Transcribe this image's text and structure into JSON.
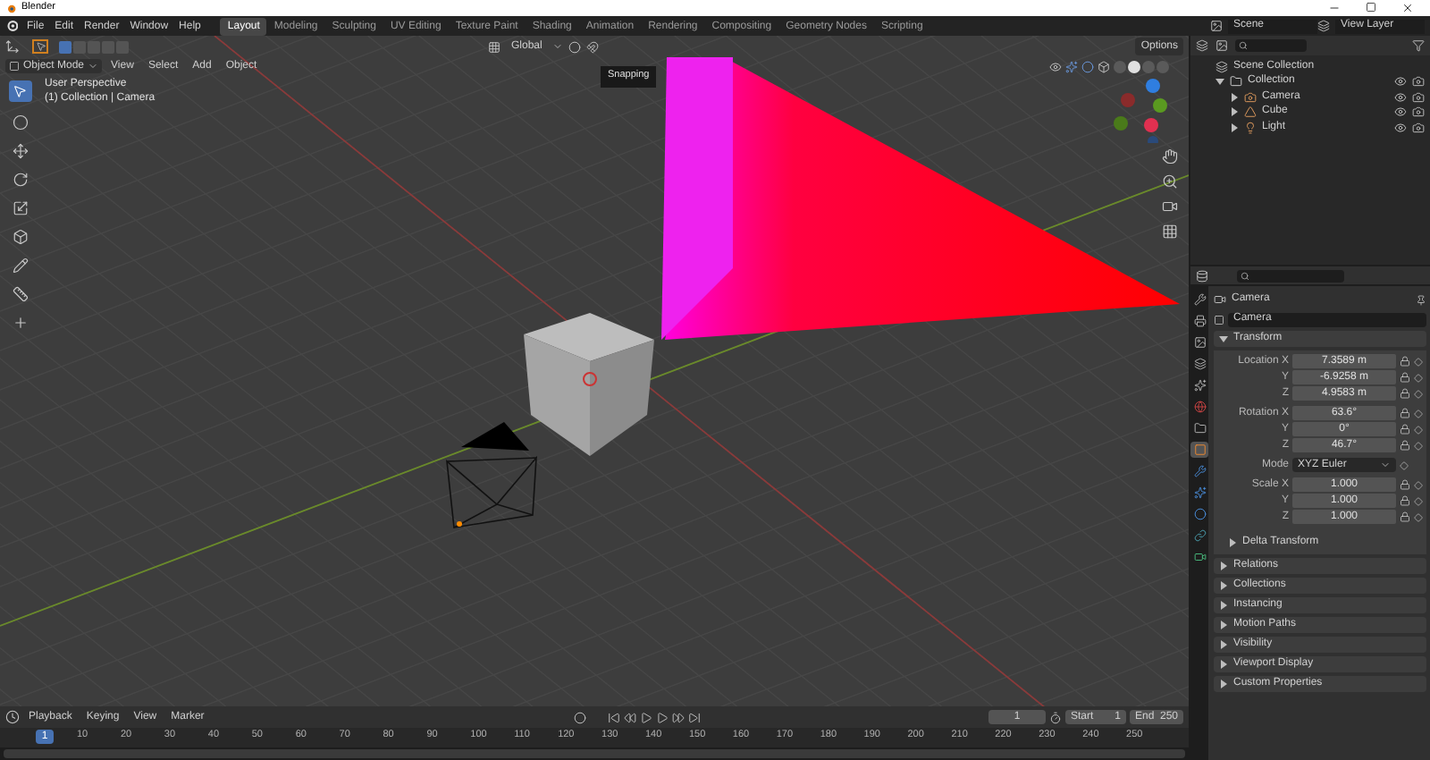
{
  "window": {
    "title": "Blender"
  },
  "menu": [
    "File",
    "Edit",
    "Render",
    "Window",
    "Help"
  ],
  "workspaces": [
    {
      "label": "Layout",
      "selected": true
    },
    {
      "label": "Modeling",
      "selected": false
    },
    {
      "label": "Sculpting",
      "selected": false
    },
    {
      "label": "UV Editing",
      "selected": false
    },
    {
      "label": "Texture Paint",
      "selected": false
    },
    {
      "label": "Shading",
      "selected": false
    },
    {
      "label": "Animation",
      "selected": false
    },
    {
      "label": "Rendering",
      "selected": false
    },
    {
      "label": "Compositing",
      "selected": false
    },
    {
      "label": "Geometry Nodes",
      "selected": false
    },
    {
      "label": "Scripting",
      "selected": false
    }
  ],
  "scene": "Scene",
  "view_layer": "View Layer",
  "viewport": {
    "orientation": "Global",
    "mode": "Object Mode",
    "menus": [
      "View",
      "Select",
      "Add",
      "Object"
    ],
    "options": "Options",
    "tooltip": "Snapping",
    "overlay": [
      "User Perspective",
      "(1) Collection | Camera"
    ]
  },
  "outliner": {
    "items": [
      {
        "label": "Scene Collection",
        "kind": "scene",
        "children": [
          {
            "label": "Collection",
            "kind": "collection",
            "expanded": true,
            "children": [
              {
                "label": "Camera",
                "kind": "camera",
                "expanded": false
              },
              {
                "label": "Cube",
                "kind": "mesh",
                "expanded": false
              },
              {
                "label": "Light",
                "kind": "light",
                "expanded": false
              }
            ]
          }
        ]
      }
    ]
  },
  "property_tabs": [
    {
      "selected": false
    },
    {
      "selected": false
    },
    {
      "selected": false
    },
    {
      "selected": false
    },
    {
      "selected": false
    },
    {
      "selected": false
    },
    {
      "selected": false
    },
    {
      "selected": true
    },
    {
      "selected": false
    },
    {
      "selected": false
    },
    {
      "selected": false
    },
    {
      "selected": false
    },
    {
      "selected": false
    }
  ],
  "properties": {
    "object": "Camera",
    "name": "Camera",
    "transform": {
      "title": "Transform",
      "expanded": true,
      "groups": [
        {
          "kind": "number",
          "rows": [
            {
              "label": "Location X",
              "value": "7.3589 m"
            },
            {
              "label": "Y",
              "value": "-6.9258 m"
            },
            {
              "label": "Z",
              "value": "4.9583 m"
            }
          ]
        },
        {
          "kind": "number",
          "rows": [
            {
              "label": "Rotation X",
              "value": "63.6°"
            },
            {
              "label": "Y",
              "value": "0°"
            },
            {
              "label": "Z",
              "value": "46.7°"
            }
          ]
        },
        {
          "kind": "select",
          "rows": [
            {
              "label": "Mode",
              "value": "XYZ Euler"
            }
          ]
        },
        {
          "kind": "number",
          "rows": [
            {
              "label": "Scale X",
              "value": "1.000"
            },
            {
              "label": "Y",
              "value": "1.000"
            },
            {
              "label": "Z",
              "value": "1.000"
            }
          ]
        }
      ],
      "subpanel": {
        "title": "Delta Transform",
        "expanded": false
      }
    },
    "panels": [
      {
        "title": "Relations",
        "expanded": false
      },
      {
        "title": "Collections",
        "expanded": false
      },
      {
        "title": "Instancing",
        "expanded": false
      },
      {
        "title": "Motion Paths",
        "expanded": false
      },
      {
        "title": "Visibility",
        "expanded": false
      },
      {
        "title": "Viewport Display",
        "expanded": false
      },
      {
        "title": "Custom Properties",
        "expanded": false
      }
    ]
  },
  "timeline": {
    "menus": [
      "Playback",
      "Keying",
      "View",
      "Marker"
    ],
    "frame": "1",
    "start_label": "Start",
    "start": "1",
    "end_label": "End",
    "end": "250",
    "playhead": "1",
    "ruler": [
      "10",
      "20",
      "30",
      "40",
      "50",
      "60",
      "70",
      "80",
      "90",
      "100",
      "110",
      "120",
      "130",
      "140",
      "150",
      "160",
      "170",
      "180",
      "190",
      "200",
      "210",
      "220",
      "230",
      "240",
      "250"
    ]
  }
}
